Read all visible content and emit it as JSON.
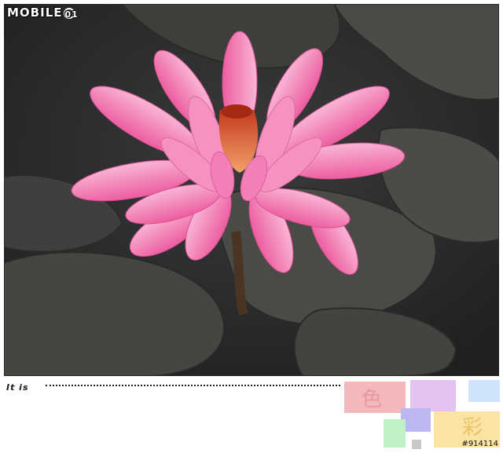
{
  "watermark": {
    "brand_text": "MOBILE",
    "brand_suffix": "01"
  },
  "caption": {
    "text": "It is"
  },
  "graphic": {
    "chars": [
      "色",
      "彩"
    ]
  },
  "post_id": "#914114",
  "colors": {
    "petal_pink": "#f06ea8",
    "petal_light": "#f7a9cf",
    "stamen": "#d9542a",
    "pad_dark": "#3c3d3a",
    "water": "#1f2022"
  }
}
